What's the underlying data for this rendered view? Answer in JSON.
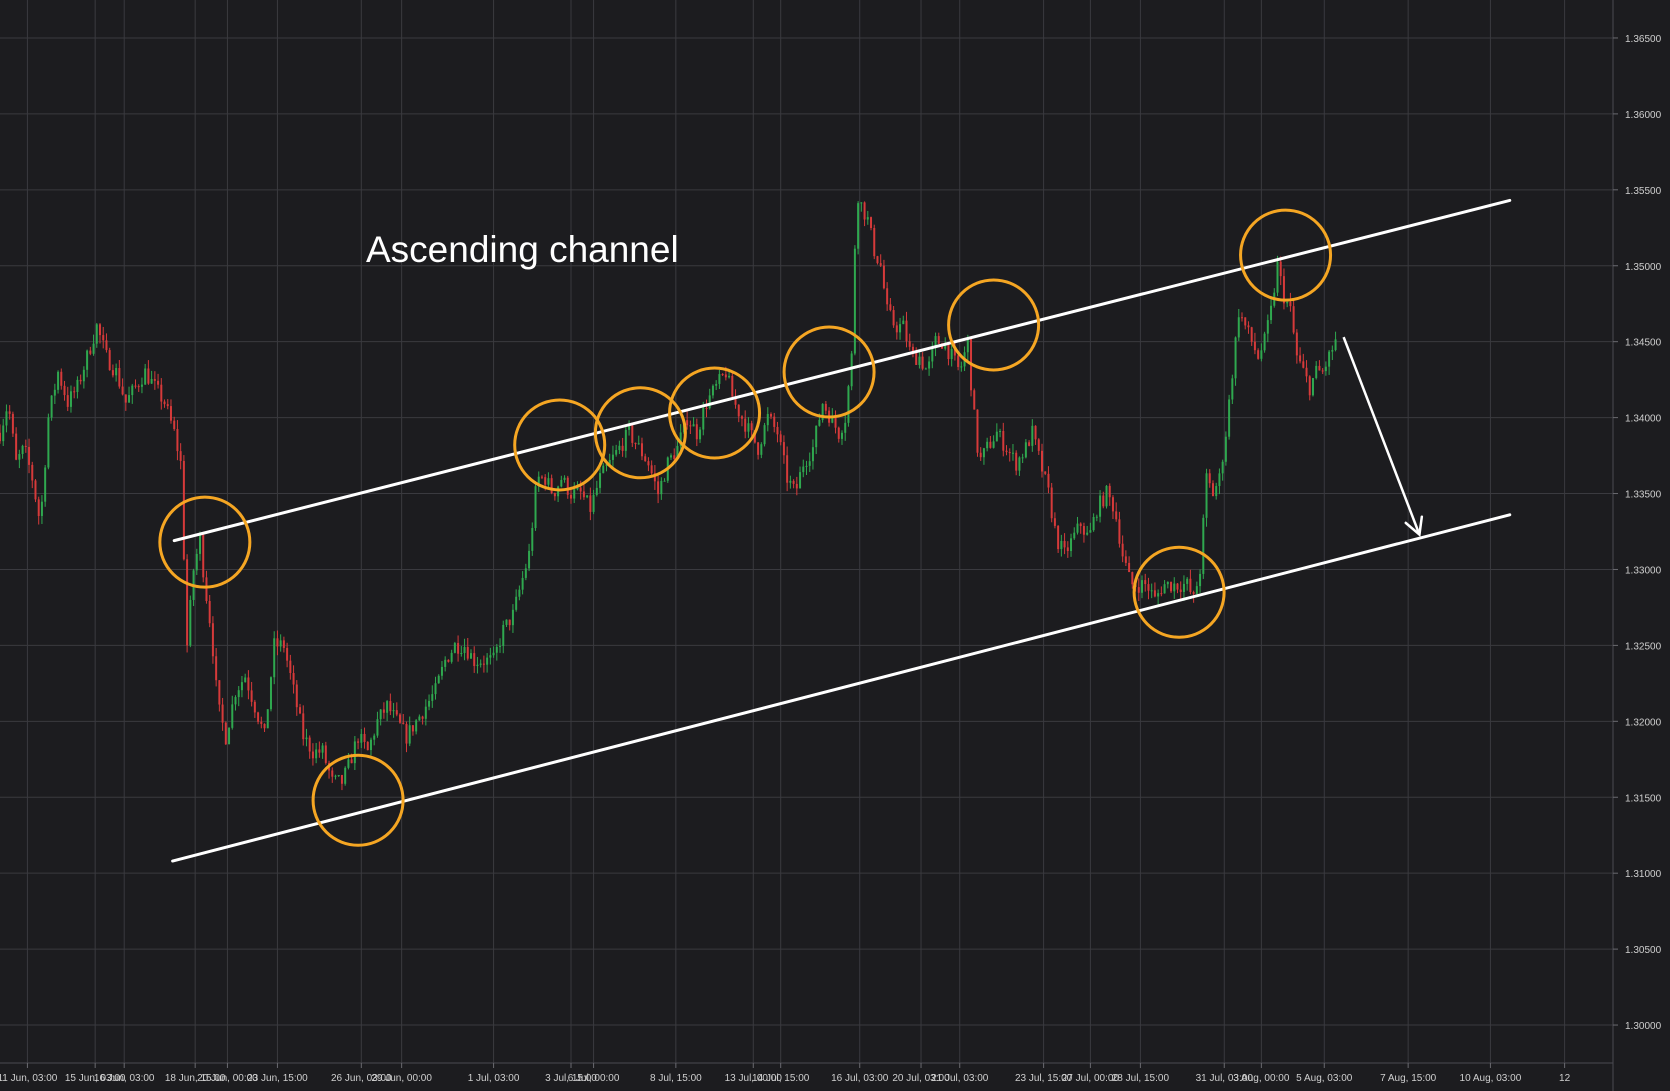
{
  "chart_data": {
    "type": "candlestick",
    "annotation": "Ascending channel",
    "colors": {
      "background": "#1c1c1f",
      "grid": "#3a3a3f",
      "up_candle": "#2fa84f",
      "down_candle": "#d63a3a",
      "channel_line": "#ffffff",
      "highlight_circle": "#f5a623",
      "axis_text": "#cfcfcf"
    },
    "ylim": [
      1.2975,
      1.3675
    ],
    "y_ticks": [
      "1.36500",
      "1.36000",
      "1.35500",
      "1.35000",
      "1.34500",
      "1.34000",
      "1.33500",
      "1.33000",
      "1.32500",
      "1.32000",
      "1.31500",
      "1.31000",
      "1.30500",
      "1.30000"
    ],
    "y_tick_values": [
      1.365,
      1.36,
      1.355,
      1.35,
      1.345,
      1.34,
      1.335,
      1.33,
      1.325,
      1.32,
      1.315,
      1.31,
      1.305,
      1.3
    ],
    "xlim": [
      0,
      1000
    ],
    "x_ticks": [
      {
        "label": "11 Jun, 03:00",
        "x": 17
      },
      {
        "label": "15 Jun, 03:00",
        "x": 59
      },
      {
        "label": "16 Jun, 03:00",
        "x": 77
      },
      {
        "label": "18 Jun, 15:00",
        "x": 121
      },
      {
        "label": "20 Jun, 00:00",
        "x": 141
      },
      {
        "label": "23 Jun, 15:00",
        "x": 172
      },
      {
        "label": "26 Jun, 03:00",
        "x": 224
      },
      {
        "label": "29 Jun, 00:00",
        "x": 249
      },
      {
        "label": "1 Jul, 03:00",
        "x": 306
      },
      {
        "label": "3 Jul, 15:00",
        "x": 354
      },
      {
        "label": "6 Jul, 00:00",
        "x": 368
      },
      {
        "label": "8 Jul, 15:00",
        "x": 419
      },
      {
        "label": "13 Jul, 00:00",
        "x": 467
      },
      {
        "label": "14 Jul, 15:00",
        "x": 484
      },
      {
        "label": "16 Jul, 03:00",
        "x": 533
      },
      {
        "label": "20 Jul, 03:00",
        "x": 571
      },
      {
        "label": "21 Jul, 03:00",
        "x": 595
      },
      {
        "label": "23 Jul, 15:00",
        "x": 647
      },
      {
        "label": "27 Jul, 00:00",
        "x": 676
      },
      {
        "label": "28 Jul, 15:00",
        "x": 707
      },
      {
        "label": "31 Jul, 03:00",
        "x": 759
      },
      {
        "label": "3 Aug, 00:00",
        "x": 782
      },
      {
        "label": "5 Aug, 03:00",
        "x": 821
      },
      {
        "label": "7 Aug, 15:00",
        "x": 873
      },
      {
        "label": "10 Aug, 03:00",
        "x": 924
      },
      {
        "label": "12",
        "x": 970
      }
    ],
    "close_path": [
      [
        0,
        1.339
      ],
      [
        5,
        1.341
      ],
      [
        10,
        1.337
      ],
      [
        15,
        1.338
      ],
      [
        20,
        1.336
      ],
      [
        25,
        1.333
      ],
      [
        30,
        1.34
      ],
      [
        36,
        1.343
      ],
      [
        42,
        1.341
      ],
      [
        48,
        1.342
      ],
      [
        54,
        1.344
      ],
      [
        60,
        1.346
      ],
      [
        66,
        1.344
      ],
      [
        72,
        1.343
      ],
      [
        78,
        1.341
      ],
      [
        84,
        1.342
      ],
      [
        90,
        1.343
      ],
      [
        96,
        1.342
      ],
      [
        102,
        1.341
      ],
      [
        108,
        1.339
      ],
      [
        112,
        1.337
      ],
      [
        116,
        1.325
      ],
      [
        120,
        1.33
      ],
      [
        124,
        1.332
      ],
      [
        127,
        1.329
      ],
      [
        131,
        1.326
      ],
      [
        135,
        1.321
      ],
      [
        140,
        1.319
      ],
      [
        146,
        1.322
      ],
      [
        152,
        1.323
      ],
      [
        158,
        1.321
      ],
      [
        164,
        1.319
      ],
      [
        170,
        1.325
      ],
      [
        176,
        1.325
      ],
      [
        182,
        1.322
      ],
      [
        188,
        1.319
      ],
      [
        194,
        1.318
      ],
      [
        200,
        1.318
      ],
      [
        206,
        1.316
      ],
      [
        212,
        1.316
      ],
      [
        216,
        1.317
      ],
      [
        222,
        1.319
      ],
      [
        228,
        1.318
      ],
      [
        234,
        1.32
      ],
      [
        240,
        1.321
      ],
      [
        246,
        1.32
      ],
      [
        252,
        1.319
      ],
      [
        258,
        1.32
      ],
      [
        264,
        1.321
      ],
      [
        270,
        1.322
      ],
      [
        276,
        1.324
      ],
      [
        282,
        1.325
      ],
      [
        288,
        1.325
      ],
      [
        294,
        1.324
      ],
      [
        300,
        1.324
      ],
      [
        306,
        1.324
      ],
      [
        312,
        1.326
      ],
      [
        318,
        1.327
      ],
      [
        323,
        1.329
      ],
      [
        328,
        1.331
      ],
      [
        333,
        1.336
      ],
      [
        338,
        1.336
      ],
      [
        343,
        1.335
      ],
      [
        348,
        1.336
      ],
      [
        354,
        1.335
      ],
      [
        360,
        1.335
      ],
      [
        366,
        1.334
      ],
      [
        372,
        1.336
      ],
      [
        378,
        1.337
      ],
      [
        384,
        1.338
      ],
      [
        390,
        1.339
      ],
      [
        396,
        1.338
      ],
      [
        402,
        1.337
      ],
      [
        408,
        1.335
      ],
      [
        414,
        1.337
      ],
      [
        420,
        1.338
      ],
      [
        426,
        1.34
      ],
      [
        432,
        1.339
      ],
      [
        438,
        1.341
      ],
      [
        444,
        1.342
      ],
      [
        450,
        1.343
      ],
      [
        455,
        1.341
      ],
      [
        460,
        1.34
      ],
      [
        465,
        1.339
      ],
      [
        470,
        1.338
      ],
      [
        476,
        1.34
      ],
      [
        482,
        1.339
      ],
      [
        488,
        1.336
      ],
      [
        493,
        1.335
      ],
      [
        498,
        1.337
      ],
      [
        504,
        1.338
      ],
      [
        510,
        1.341
      ],
      [
        515,
        1.34
      ],
      [
        520,
        1.339
      ],
      [
        524,
        1.34
      ],
      [
        528,
        1.344
      ],
      [
        531,
        1.355
      ],
      [
        534,
        1.354
      ],
      [
        538,
        1.353
      ],
      [
        542,
        1.351
      ],
      [
        546,
        1.35
      ],
      [
        550,
        1.347
      ],
      [
        555,
        1.346
      ],
      [
        560,
        1.346
      ],
      [
        565,
        1.344
      ],
      [
        570,
        1.344
      ],
      [
        575,
        1.343
      ],
      [
        580,
        1.345
      ],
      [
        585,
        1.345
      ],
      [
        590,
        1.344
      ],
      [
        595,
        1.343
      ],
      [
        600,
        1.345
      ],
      [
        603,
        1.341
      ],
      [
        607,
        1.337
      ],
      [
        612,
        1.338
      ],
      [
        618,
        1.339
      ],
      [
        624,
        1.338
      ],
      [
        630,
        1.337
      ],
      [
        636,
        1.338
      ],
      [
        640,
        1.339
      ],
      [
        645,
        1.337
      ],
      [
        650,
        1.335
      ],
      [
        655,
        1.332
      ],
      [
        660,
        1.331
      ],
      [
        665,
        1.332
      ],
      [
        670,
        1.333
      ],
      [
        675,
        1.332
      ],
      [
        680,
        1.334
      ],
      [
        686,
        1.335
      ],
      [
        691,
        1.334
      ],
      [
        696,
        1.331
      ],
      [
        701,
        1.329
      ],
      [
        706,
        1.329
      ],
      [
        711,
        1.329
      ],
      [
        716,
        1.328
      ],
      [
        721,
        1.329
      ],
      [
        726,
        1.329
      ],
      [
        731,
        1.329
      ],
      [
        736,
        1.329
      ],
      [
        740,
        1.328
      ],
      [
        744,
        1.33
      ],
      [
        748,
        1.336
      ],
      [
        752,
        1.335
      ],
      [
        756,
        1.336
      ],
      [
        760,
        1.339
      ],
      [
        764,
        1.343
      ],
      [
        768,
        1.347
      ],
      [
        772,
        1.346
      ],
      [
        776,
        1.345
      ],
      [
        780,
        1.344
      ],
      [
        784,
        1.345
      ],
      [
        788,
        1.347
      ],
      [
        792,
        1.35
      ],
      [
        796,
        1.348
      ],
      [
        800,
        1.347
      ],
      [
        804,
        1.344
      ],
      [
        808,
        1.343
      ],
      [
        812,
        1.342
      ],
      [
        816,
        1.343
      ],
      [
        820,
        1.343
      ],
      [
        824,
        1.344
      ],
      [
        828,
        1.345
      ]
    ],
    "candle_range": [
      0,
      828
    ],
    "candle_step": 2,
    "channel_lines": [
      {
        "name": "upper",
        "from": [
          108,
          1.3319
        ],
        "to": [
          936,
          1.3543
        ]
      },
      {
        "name": "lower",
        "from": [
          107,
          1.3108
        ],
        "to": [
          936,
          1.3336
        ]
      }
    ],
    "arrow": {
      "from": [
        833,
        1.3453
      ],
      "to": [
        880,
        1.3323
      ]
    },
    "highlight_circles": [
      {
        "x": 127,
        "y": 1.3318,
        "r": 23
      },
      {
        "x": 222,
        "y": 1.3148,
        "r": 23
      },
      {
        "x": 347,
        "y": 1.3382,
        "r": 23
      },
      {
        "x": 397,
        "y": 1.339,
        "r": 23
      },
      {
        "x": 443,
        "y": 1.3403,
        "r": 23
      },
      {
        "x": 514,
        "y": 1.343,
        "r": 23
      },
      {
        "x": 616,
        "y": 1.3461,
        "r": 23
      },
      {
        "x": 731,
        "y": 1.3285,
        "r": 23
      },
      {
        "x": 797,
        "y": 1.3507,
        "r": 23
      }
    ]
  }
}
